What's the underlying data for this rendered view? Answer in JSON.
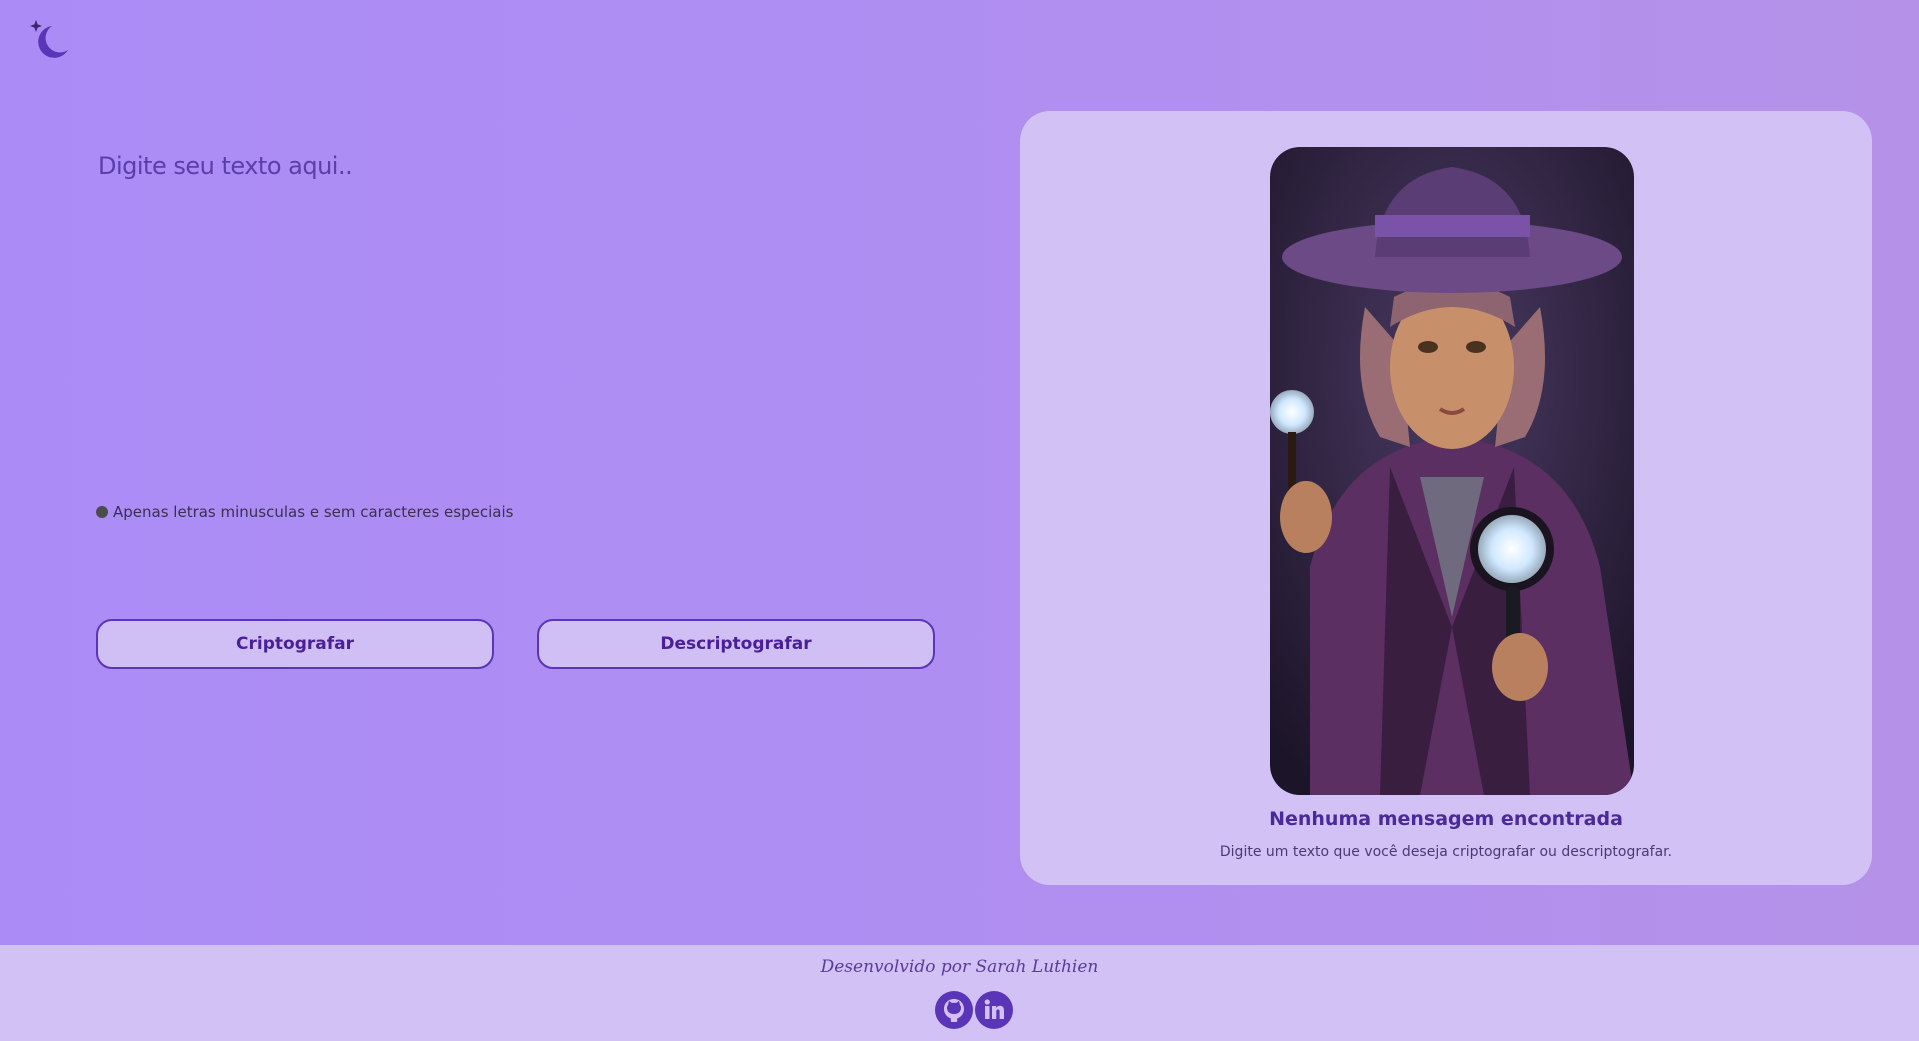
{
  "input": {
    "placeholder": "Digite seu texto aqui.."
  },
  "hint": {
    "text": "Apenas letras minusculas e sem caracteres especiais"
  },
  "buttons": {
    "encrypt": "Criptografar",
    "decrypt": "Descriptografar"
  },
  "output_panel": {
    "title": "Nenhuma mensagem encontrada",
    "subtitle": "Digite um texto que você deseja criptografar ou descriptografar."
  },
  "footer": {
    "credit": "Desenvolvido por Sarah Luthien",
    "links": [
      {
        "icon": "github-icon",
        "label": "GitHub"
      },
      {
        "icon": "linkedin-icon",
        "label": "LinkedIn"
      }
    ]
  },
  "colors": {
    "accent": "#4a1f97",
    "background": "#ab8cf6",
    "panel": "#d2c1f5"
  }
}
